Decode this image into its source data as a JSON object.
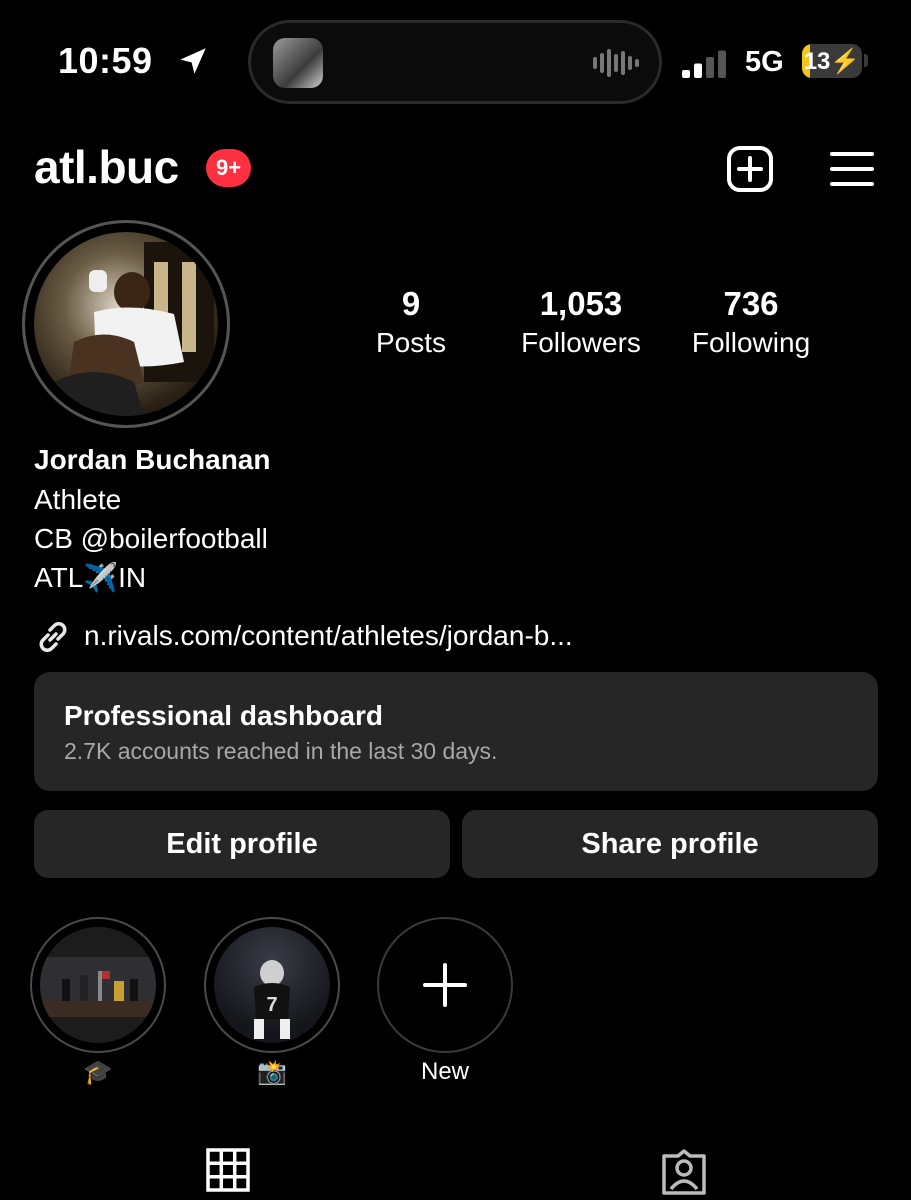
{
  "status_bar": {
    "time": "10:59",
    "network": "5G",
    "battery": "13",
    "battery_level": 0.13,
    "signal_bars_filled": 2,
    "signal_bars_total": 4
  },
  "header": {
    "username": "atl.buc",
    "notification_badge": "9+",
    "icons": [
      "plus-square-icon",
      "hamburger-menu-icon"
    ]
  },
  "profile": {
    "stats": [
      {
        "value": "9",
        "label": "Posts"
      },
      {
        "value": "1,053",
        "label": "Followers"
      },
      {
        "value": "736",
        "label": "Following"
      }
    ],
    "full_name": "Jordan Buchanan",
    "category": "Athlete",
    "bio_lines": [
      "CB @boilerfootball",
      "ATL✈️IN"
    ],
    "link": "n.rivals.com/content/athletes/jordan-b..."
  },
  "dashboard": {
    "title": "Professional dashboard",
    "subtitle": "2.7K accounts reached in the last 30 days."
  },
  "buttons": {
    "edit": "Edit profile",
    "share": "Share profile"
  },
  "highlights": [
    {
      "label": "🎓"
    },
    {
      "label": "📸"
    },
    {
      "label": "New"
    }
  ],
  "tabs": [
    "grid-icon",
    "tagged-icon"
  ],
  "colors": {
    "background": "#000000",
    "badge": "#ff3040",
    "surface": "#262626",
    "secondary_text": "#a8a8a8",
    "battery": "#f5c518"
  }
}
